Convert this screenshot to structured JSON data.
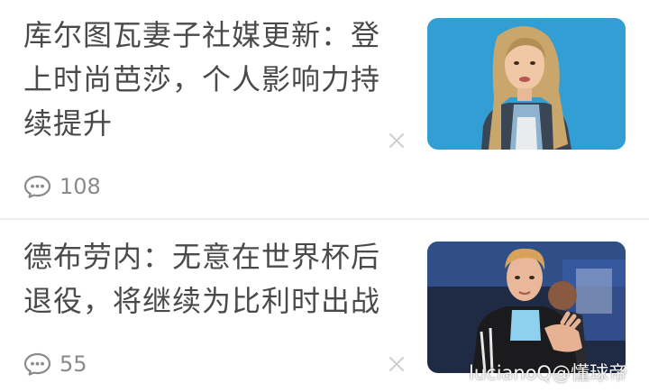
{
  "feed": {
    "items": [
      {
        "title": "库尔图瓦妻子社媒更新：登上时尚芭莎，个人影响力持续提升",
        "comment_count": "108",
        "image": "woman-portrait-photo"
      },
      {
        "title": "德布劳内：无意在世界杯后退役，将继续为比利时出战",
        "comment_count": "55",
        "image": "footballer-applauding-photo"
      }
    ]
  },
  "watermark": "lucianoQ@懂球帝",
  "icons": {
    "comment": "speech-bubble-icon",
    "dismiss": "close-icon"
  },
  "colors": {
    "title_text": "#4a4a4a",
    "meta_text": "#8a8a8a",
    "divider": "#ededed",
    "thumb1_background": "#2f9ad0"
  }
}
